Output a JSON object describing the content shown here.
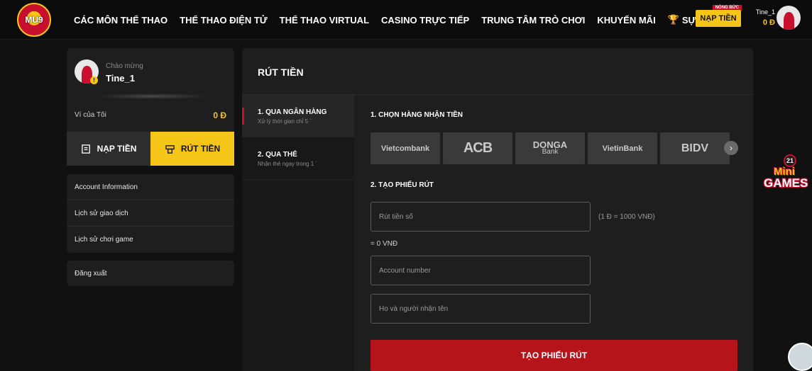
{
  "brand": {
    "logo_text": "MU9"
  },
  "nav": {
    "items": [
      "CÁC MÔN THỂ THAO",
      "THỂ THAO ĐIỆN TỬ",
      "THỂ THAO VIRTUAL",
      "CASINO TRỰC TIẾP",
      "TRUNG TÂM TRÒ CHƠI",
      "KHUYẾN MÃI"
    ],
    "event_label": "SỰ KIỆN",
    "event_tag": "NÓNG BỨC",
    "deposit_label": "NẠP TIỀN",
    "username": "Tine_1",
    "balance": "0 Đ"
  },
  "profile": {
    "greeting": "Chào mừng",
    "username": "Tine_1",
    "badge": "!",
    "wallet_label": "Ví của Tôi",
    "wallet_amount": "0 Đ",
    "deposit_label": "NẠP TIỀN",
    "withdraw_label": "RÚT TIỀN"
  },
  "menu": {
    "items": [
      "Account Information",
      "Lịch sử giao dịch",
      "Lịch sử chơi game"
    ],
    "logout": "Đăng xuất"
  },
  "withdraw": {
    "title": "RÚT TIỀN",
    "methods": [
      {
        "title": "1. QUA NGÂN HÀNG",
        "subtitle": "Xử lý thời gian chỉ 5 `"
      },
      {
        "title": "2. QUA THẺ",
        "subtitle": "Nhận thẻ ngay trong 1 `"
      }
    ],
    "step1_label": "1. CHỌN HÀNG NHẬN TIỀN",
    "banks": [
      "Vietcombank",
      "ACB",
      "DONGA",
      "VietinBank",
      "BIDV"
    ],
    "donga_sub": "Bank",
    "step2_label": "2. TẠO PHIẾU RÚT",
    "amount_placeholder": "Rút tiền số",
    "rate_text": "(1 Đ = 1000 VNĐ)",
    "converted_text": "= 0 VNĐ",
    "account_placeholder": "Account number",
    "name_placeholder": "Họ và người nhận tên",
    "submit_label": "TẠO PHIẾU RÚT"
  },
  "widgets": {
    "minigames_badge": "21",
    "minigames_line1": "Mini",
    "minigames_line2": "GAMES"
  },
  "colors": {
    "accent": "#f5c518",
    "brand_red": "#c8102e",
    "background": "#111111",
    "panel": "#1e1e1e"
  }
}
